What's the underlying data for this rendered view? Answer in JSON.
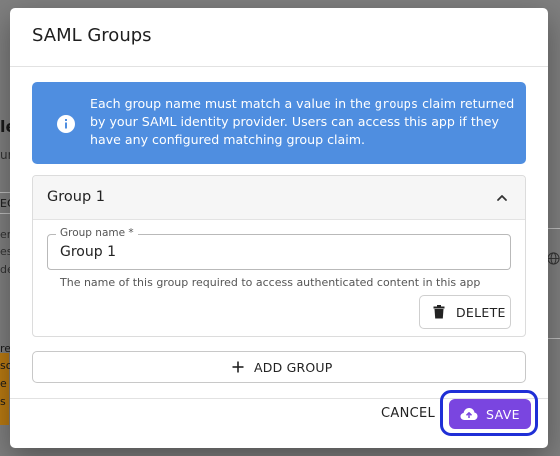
{
  "dialog": {
    "title": "SAML Groups",
    "info": {
      "text_before": "Each group name must match a value in the ",
      "code": "groups",
      "text_after": " claim returned by your SAML identity provider. Users can access this app if they have any configured matching group claim."
    },
    "groups": [
      {
        "title": "Group 1",
        "field_label": "Group name *",
        "field_value": "Group 1",
        "helper": "The name of this group required to access authenticated content in this app",
        "delete_label": "DELETE"
      }
    ],
    "add_group_label": "ADD GROUP",
    "cancel_label": "CANCEL",
    "save_label": "SAVE"
  },
  "background": {
    "fragments": [
      "le",
      "ur",
      "EC",
      "er",
      "es",
      "de",
      "re",
      "so",
      "e",
      "s"
    ]
  },
  "colors": {
    "info_bg": "#4f8ee0",
    "save_bg": "#7a45e0",
    "focus_ring": "#1f2fd6"
  },
  "icons": [
    "info-icon",
    "chevron-up-icon",
    "trash-icon",
    "plus-icon",
    "cloud-upload-icon",
    "globe-icon"
  ]
}
